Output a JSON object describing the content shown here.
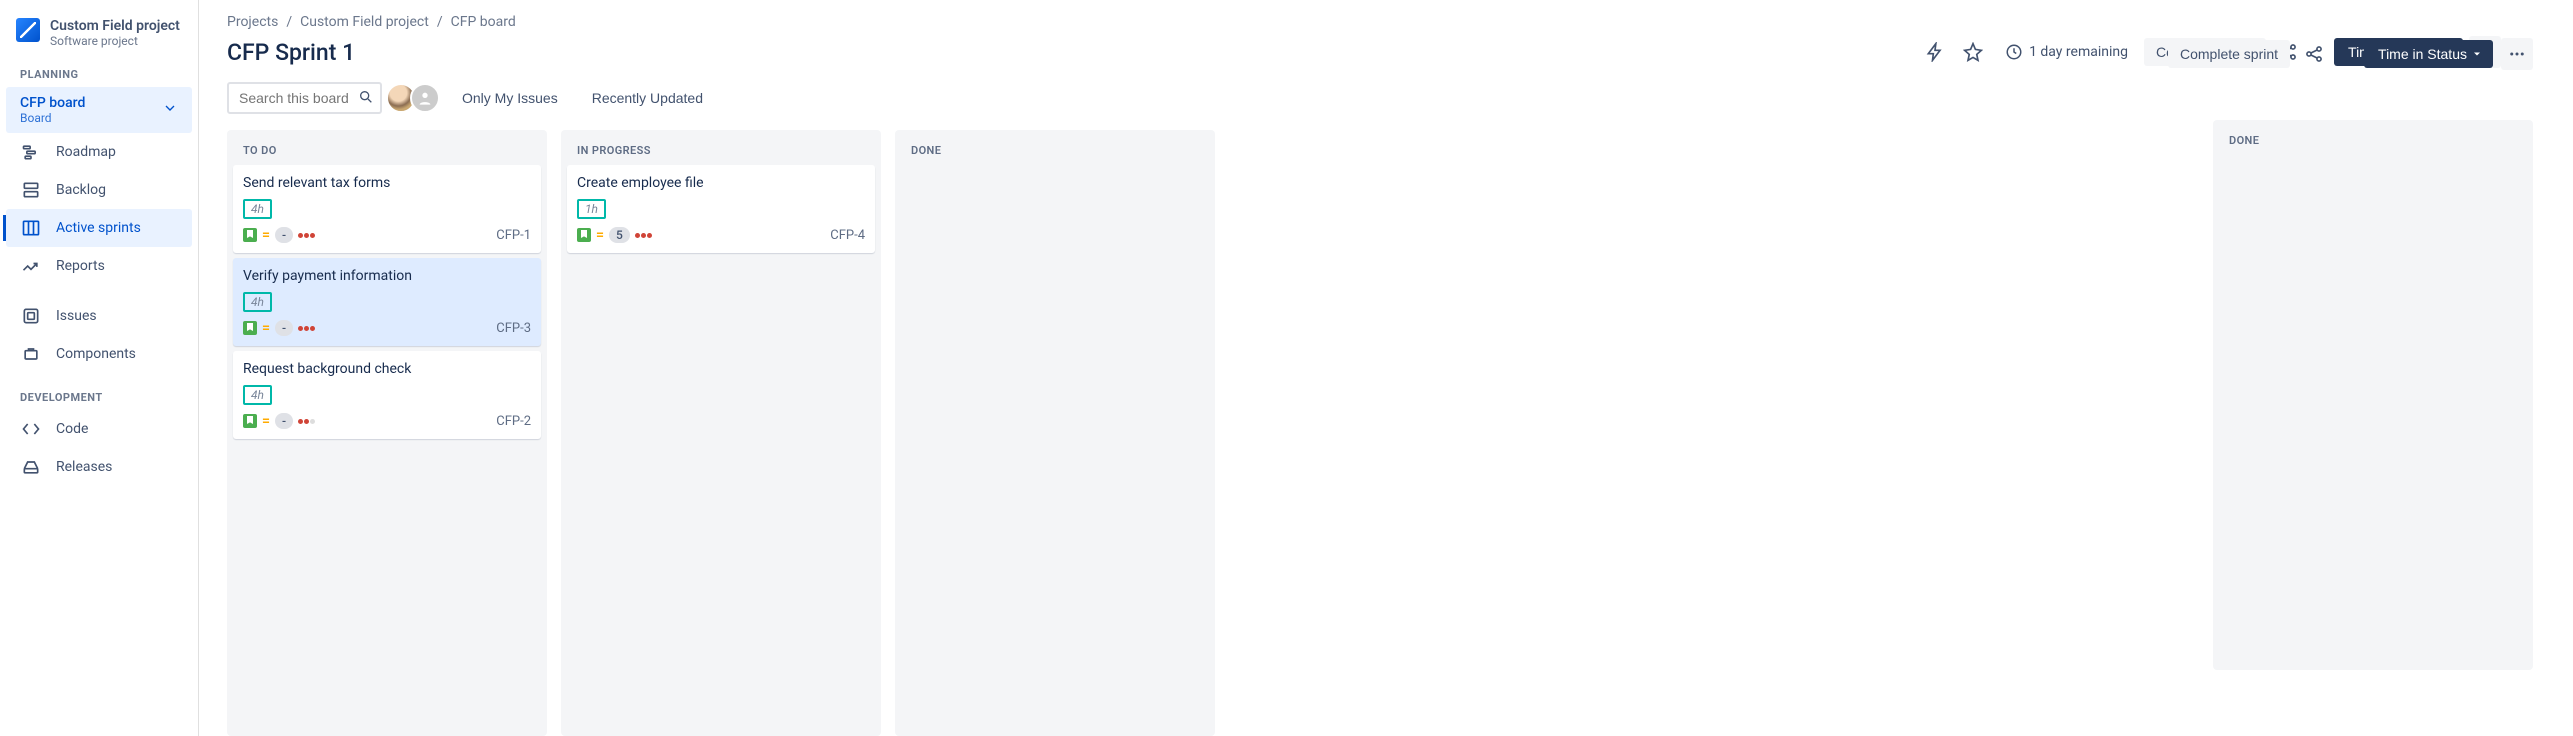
{
  "project": {
    "name": "Custom Field project",
    "type": "Software project"
  },
  "sidebar": {
    "planning_label": "PLANNING",
    "development_label": "DEVELOPMENT",
    "board_group": {
      "title": "CFP board",
      "subtitle": "Board"
    },
    "items_planning": [
      {
        "label": "Roadmap"
      },
      {
        "label": "Backlog"
      },
      {
        "label": "Active sprints"
      },
      {
        "label": "Reports"
      },
      {
        "label": "Issues"
      },
      {
        "label": "Components"
      }
    ],
    "items_dev": [
      {
        "label": "Code"
      },
      {
        "label": "Releases"
      }
    ]
  },
  "breadcrumb": [
    "Projects",
    "Custom Field project",
    "CFP board"
  ],
  "header": {
    "title": "CFP Sprint 1",
    "remaining": "1 day remaining",
    "complete": "Complete sprint",
    "time_in_status": "Time in Status"
  },
  "search": {
    "placeholder": "Search this board"
  },
  "filters": {
    "mine": "Only My Issues",
    "recent": "Recently Updated"
  },
  "columns": [
    {
      "title": "TO DO",
      "cards": [
        {
          "title": "Send relevant tax forms",
          "est": "4h",
          "badge": "-",
          "key": "CFP-1",
          "dots": [
            "#d04437",
            "#d04437",
            "#d04437"
          ]
        },
        {
          "title": "Verify payment information",
          "est": "4h",
          "badge": "-",
          "key": "CFP-3",
          "dots": [
            "#d04437",
            "#d04437",
            "#d04437"
          ],
          "selected": true
        },
        {
          "title": "Request background check",
          "est": "4h",
          "badge": "-",
          "key": "CFP-2",
          "dots": [
            "#d04437",
            "#d04437",
            "#ddd"
          ]
        }
      ]
    },
    {
      "title": "IN PROGRESS",
      "cards": [
        {
          "title": "Create employee file",
          "est": "1h",
          "badge": "5",
          "key": "CFP-4",
          "dots": [
            "#d04437",
            "#d04437",
            "#d04437"
          ]
        }
      ]
    },
    {
      "title": "DONE",
      "cards": []
    }
  ],
  "dup_col_title": "DONE"
}
